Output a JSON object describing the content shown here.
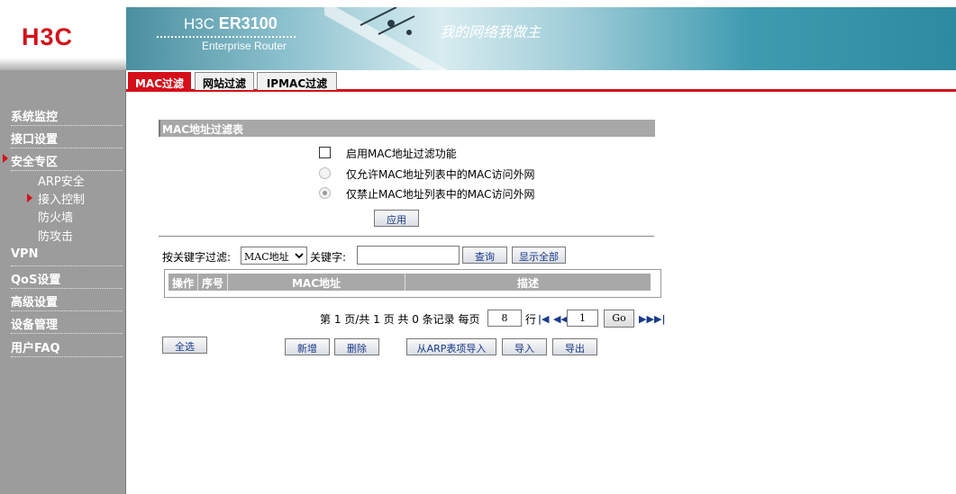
{
  "brand": {
    "logo": "H3C"
  },
  "banner": {
    "product_prefix": "H3C ",
    "product_model": "ER3100",
    "subtitle": "Enterprise Router",
    "slogan": "我的网络我做主"
  },
  "sidebar": {
    "items": [
      {
        "label": "系统监控"
      },
      {
        "label": "接口设置"
      },
      {
        "label": "安全专区"
      },
      {
        "label": "VPN"
      },
      {
        "label": "QoS设置"
      },
      {
        "label": "高级设置"
      },
      {
        "label": "设备管理"
      },
      {
        "label": "用户FAQ"
      }
    ],
    "sub_items": [
      {
        "label": "ARP安全"
      },
      {
        "label": "接入控制"
      },
      {
        "label": "防火墙"
      },
      {
        "label": "防攻击"
      }
    ]
  },
  "tabs": [
    {
      "label": "MAC过滤"
    },
    {
      "label": "网站过滤"
    },
    {
      "label": "IPMAC过滤"
    }
  ],
  "section": {
    "title": "MAC地址过滤表",
    "enable_label": "启用MAC地址过滤功能",
    "allow_label": "仅允许MAC地址列表中的MAC访问外网",
    "deny_label": "仅禁止MAC地址列表中的MAC访问外网",
    "apply_label": "应用"
  },
  "filter": {
    "keyword_filter_label": "按关键字过滤:",
    "select_value": "MAC地址",
    "keyword_label": "关键字:",
    "keyword_value": "",
    "query_label": "查询",
    "show_all_label": "显示全部"
  },
  "table": {
    "columns": [
      "操作",
      "序号",
      "MAC地址",
      "描述"
    ]
  },
  "pager": {
    "text_prefix": "第 1 页/共 1 页 共 0 条记录 每页",
    "per_page": "8",
    "row_label": "行",
    "page_value": "1",
    "go_label": "Go"
  },
  "actions": {
    "select_all": "全选",
    "add": "新增",
    "delete": "删除",
    "import_arp": "从ARP表项导入",
    "import": "导入",
    "export": "导出"
  }
}
